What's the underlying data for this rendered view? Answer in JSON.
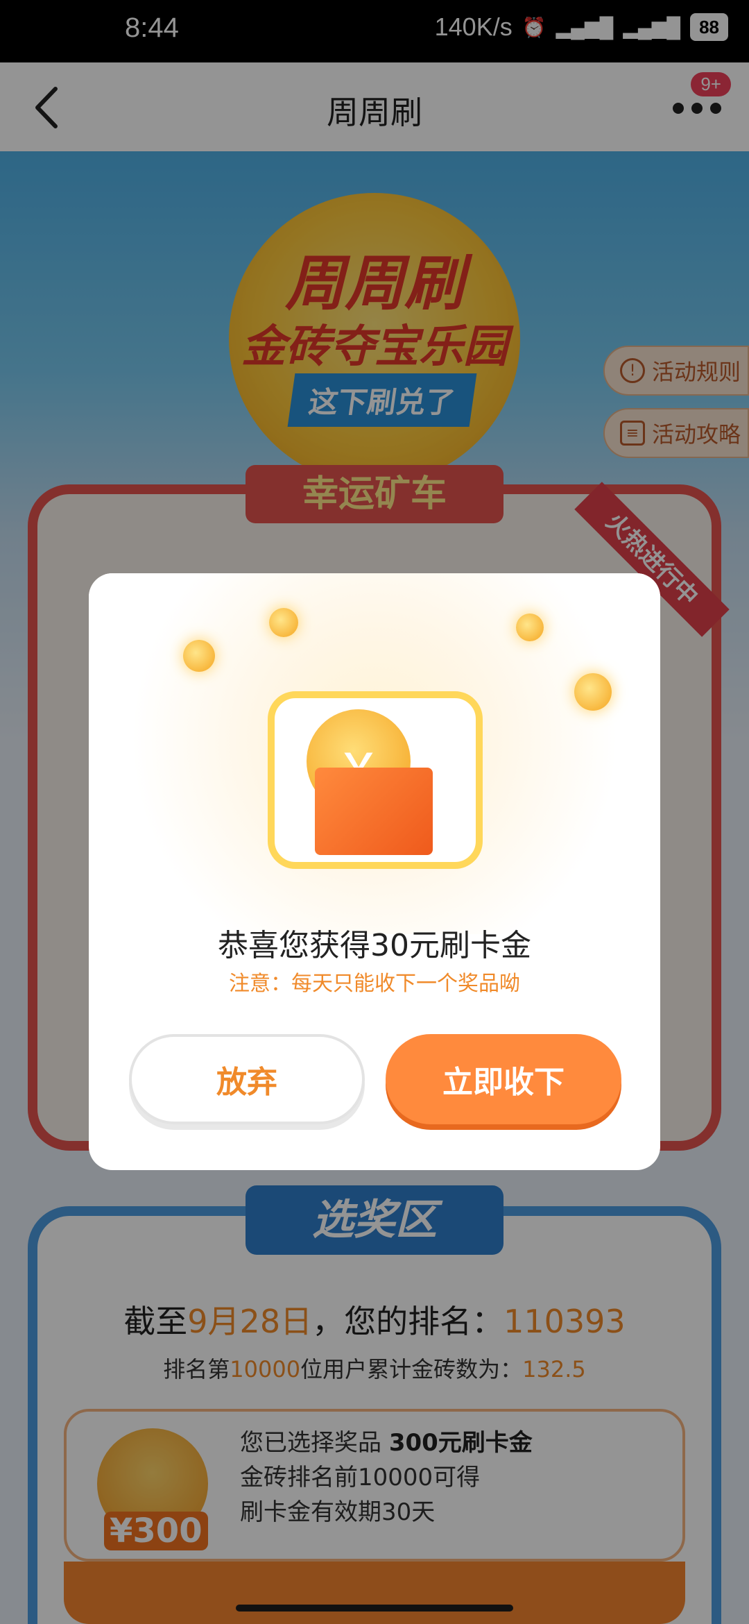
{
  "status_bar": {
    "time": "8:44",
    "net_speed": "140K/s",
    "battery": "88"
  },
  "header": {
    "title": "周周刷",
    "badge": "9+"
  },
  "hero": {
    "title_line1": "周周刷",
    "title_line2": "金砖夺宝乐园",
    "subtitle": "这下刷兑了"
  },
  "side_buttons": {
    "rules": "活动规则",
    "guide": "活动攻略"
  },
  "lucky_cart": {
    "title": "幸运矿车",
    "ribbon": "火热进行中"
  },
  "prize_zone": {
    "title": "选奖区",
    "rank_prefix": "截至",
    "rank_date": "9月28日",
    "rank_mid": "，您的排名：",
    "rank_value": "110393",
    "sub_prefix": "排名第",
    "sub_rank": "10000",
    "sub_mid": "位用户累计金砖数为：",
    "sub_value": "132.5",
    "selected_label": "您已选择奖品",
    "selected_prize": "300元刷卡金",
    "condition": "金砖排名前10000可得",
    "validity": "刷卡金有效期30天",
    "prize_amount": "¥300"
  },
  "dialog": {
    "message": "恭喜您获得30元刷卡金",
    "note": "注意：每天只能收下一个奖品呦",
    "abandon_label": "放弃",
    "accept_label": "立即收下",
    "coin_symbol": "￥"
  }
}
